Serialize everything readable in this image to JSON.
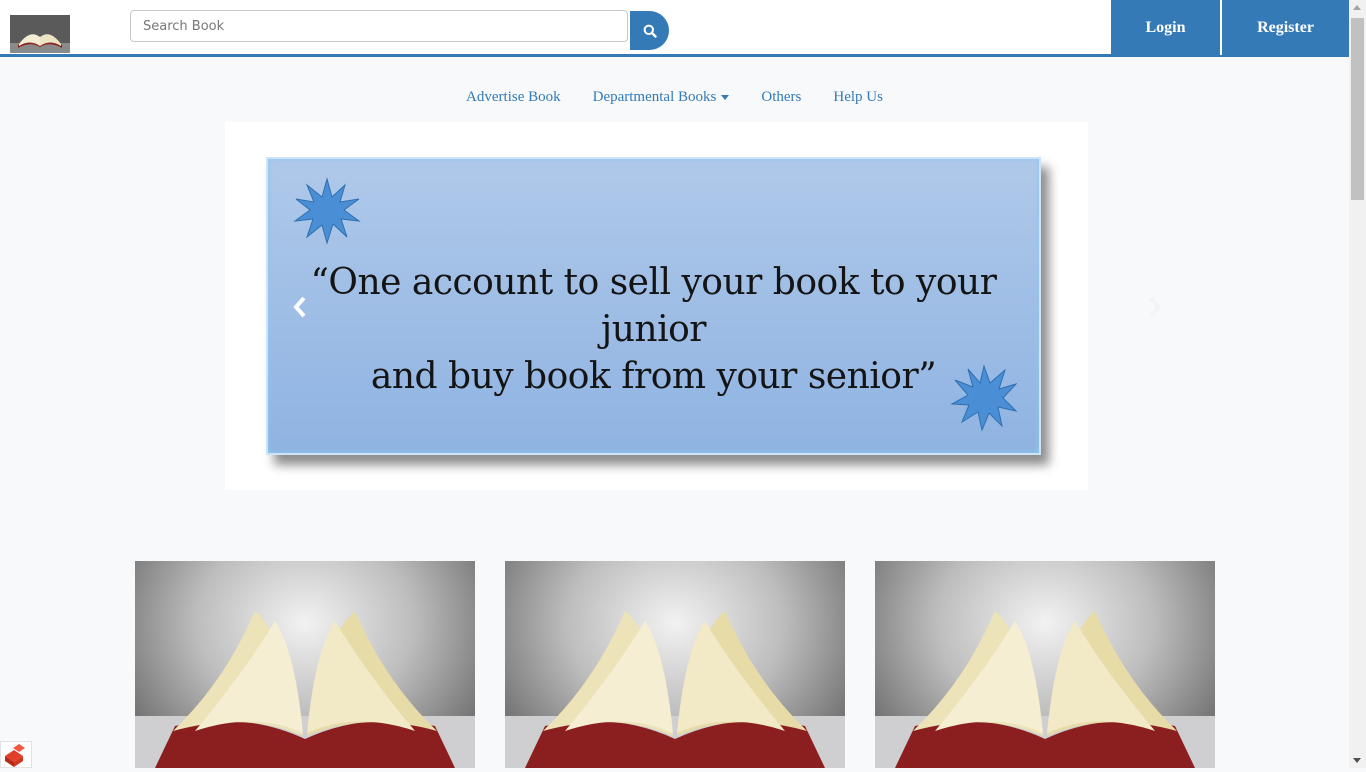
{
  "header": {
    "search": {
      "placeholder": "Search Book",
      "value": ""
    },
    "login_label": "Login",
    "register_label": "Register"
  },
  "nav": {
    "items": [
      {
        "label": "Advertise Book"
      },
      {
        "label": "Departmental Books"
      },
      {
        "label": "Others"
      },
      {
        "label": "Help Us"
      }
    ]
  },
  "carousel": {
    "quote_line1": "“One account to sell your book to your junior",
    "quote_line2": "and buy book from your senior”",
    "prev_icon": "chevron-left-icon",
    "next_icon": "chevron-right-icon"
  },
  "colors": {
    "primary": "#337ab7",
    "slide_top": "#afc9e9",
    "slide_bottom": "#8fb3e2",
    "star": "#4a8fd6"
  }
}
